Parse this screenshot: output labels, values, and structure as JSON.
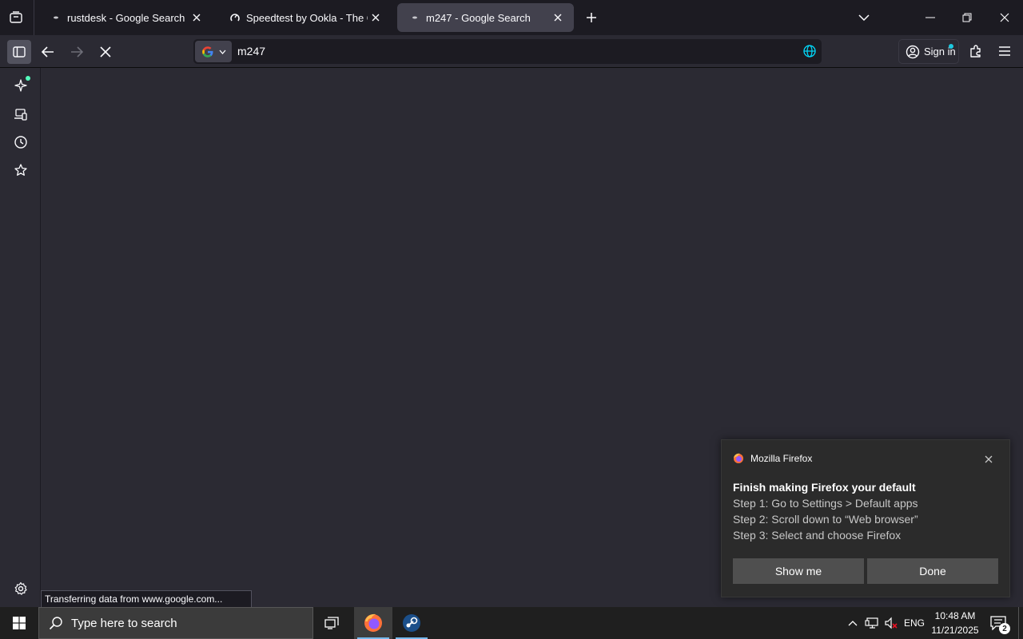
{
  "tabs": [
    {
      "title": "rustdesk - Google Search",
      "favicon": "loading-dot-icon",
      "active": false
    },
    {
      "title": "Speedtest by Ookla - The Global Broadband Speed Test",
      "favicon": "speedtest-icon",
      "active": false
    },
    {
      "title": "m247 - Google Search",
      "favicon": "loading-dot-icon",
      "active": true
    }
  ],
  "urlbar": {
    "value": "m247",
    "engine": "google-icon"
  },
  "account": {
    "signin_label": "Sign in"
  },
  "status": {
    "text": "Transferring data from www.google.com..."
  },
  "toast": {
    "app_name": "Mozilla Firefox",
    "title": "Finish making Firefox your default",
    "lines": [
      "Step 1: Go to Settings > Default apps",
      "Step 2: Scroll down to “Web browser”",
      "Step 3: Select and choose Firefox"
    ],
    "primary_label": "Show me",
    "secondary_label": "Done"
  },
  "taskbar": {
    "search_placeholder": "Type here to search",
    "language": "ENG",
    "time": "10:48 AM",
    "date": "11/21/2025",
    "notification_count": "2"
  },
  "colors": {
    "accent": "#76b9ed",
    "notification_dot": "#54ffbd",
    "signin_dot": "#1dc9e0"
  }
}
